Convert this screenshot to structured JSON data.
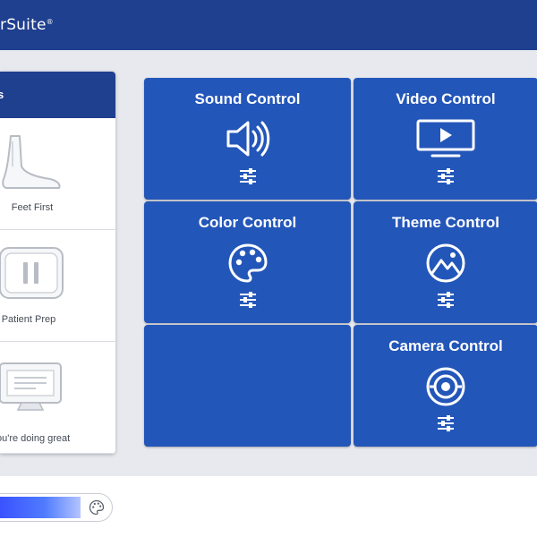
{
  "header": {
    "brand_text": "rSuite",
    "brand_mark": "®"
  },
  "sidebar": {
    "title": "s",
    "items": [
      {
        "label": "Feet First",
        "icon": "foot-icon"
      },
      {
        "label": "Patient Prep",
        "icon": "pause-icon"
      },
      {
        "label": "ou're doing great",
        "icon": "monitor-icon"
      }
    ]
  },
  "tiles": [
    {
      "title": "Sound Control",
      "icon": "speaker-icon"
    },
    {
      "title": "Video Control",
      "icon": "tv-play-icon"
    },
    {
      "title": "Color Control",
      "icon": "palette-icon"
    },
    {
      "title": "Theme Control",
      "icon": "landscape-icon"
    },
    {
      "title": "",
      "icon": ""
    },
    {
      "title": "Camera Control",
      "icon": "camera-icon"
    }
  ],
  "colors": {
    "header": "#1f3f8f",
    "tile": "#2356b9",
    "background": "#e7e9ef"
  }
}
